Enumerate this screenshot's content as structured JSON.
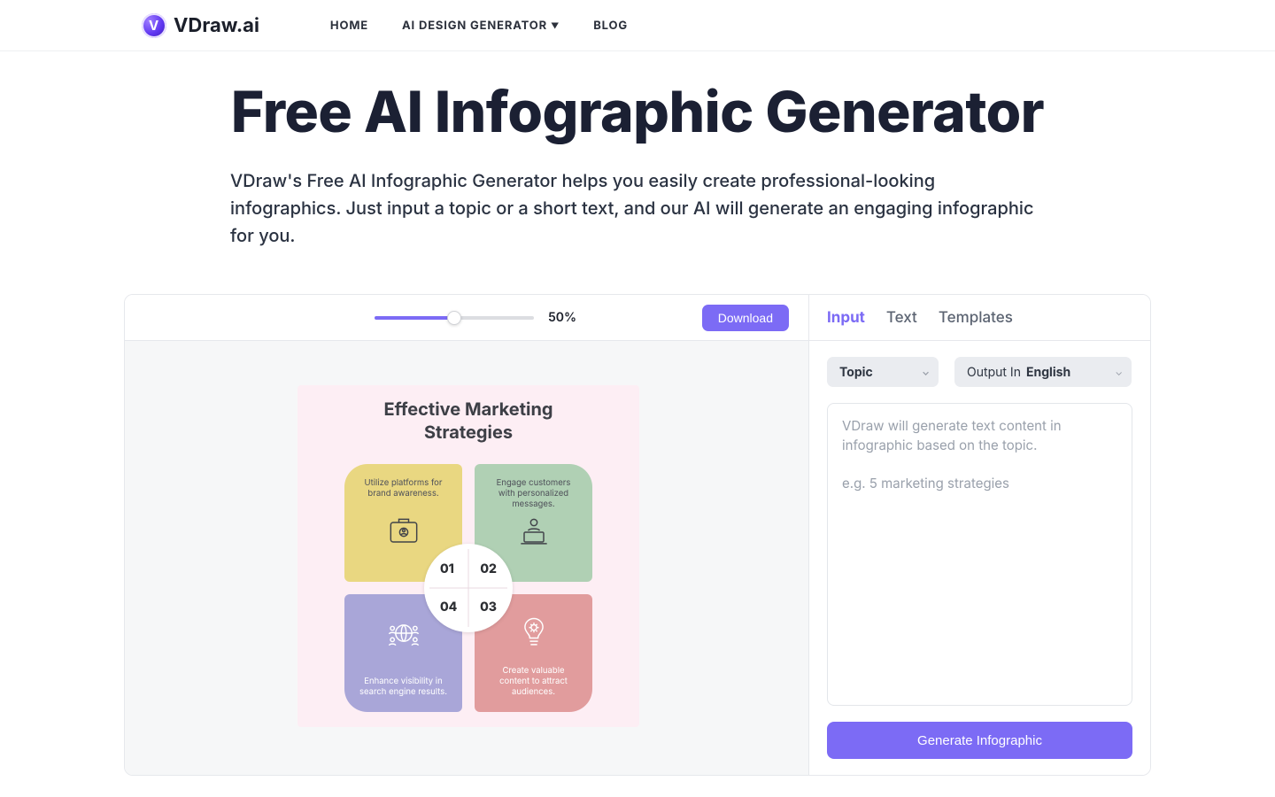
{
  "brand": "VDraw.ai",
  "nav": {
    "home": "HOME",
    "generator": "AI DESIGN GENERATOR",
    "blog": "BLOG"
  },
  "hero": {
    "title": "Free AI Infographic Generator",
    "desc": "VDraw's Free AI Infographic Generator helps you easily create professional-looking infographics. Just input a topic or a short text, and our AI will generate an engaging infographic for you."
  },
  "toolbar": {
    "zoom_pct": 50,
    "zoom_label": "50%",
    "download": "Download"
  },
  "panel": {
    "tabs": {
      "input": "Input",
      "text": "Text",
      "templates": "Templates"
    },
    "topic_label": "Topic",
    "output_in_prefix": "Output In",
    "output_in_lang": "English",
    "placeholder": "VDraw will generate text content in infographic based on the topic.\n\ne.g. 5 marketing strategies",
    "generate": "Generate Infographic"
  },
  "infographic": {
    "title_line1": "Effective Marketing",
    "title_line2": "Strategies",
    "q1": "Utilize platforms for brand awareness.",
    "q2": "Engage customers with personalized messages.",
    "q3": "Create valuable content to attract audiences.",
    "q4": "Enhance visibility in search engine results.",
    "n1": "01",
    "n2": "02",
    "n3": "03",
    "n4": "04"
  }
}
